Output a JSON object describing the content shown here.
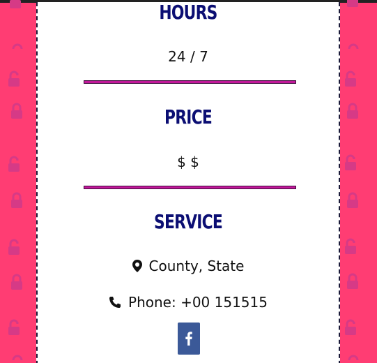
{
  "colors": {
    "background": "#ff3d73",
    "card": "#ffffff",
    "heading": "#0b0e73",
    "divider": "#c2189a",
    "facebook": "#3b5998",
    "pattern_lock": "#d63a86"
  },
  "sections": {
    "hours": {
      "title": "HOURS",
      "value": "24 / 7"
    },
    "price": {
      "title": "PRICE",
      "value": "$ $"
    },
    "service": {
      "title": "SERVICE",
      "location": "County, State",
      "phone": "Phone: +00 151515"
    }
  },
  "icons": {
    "location": "map-marker-icon",
    "phone": "phone-icon",
    "facebook": "facebook-icon",
    "pattern": "padlock-icon"
  }
}
